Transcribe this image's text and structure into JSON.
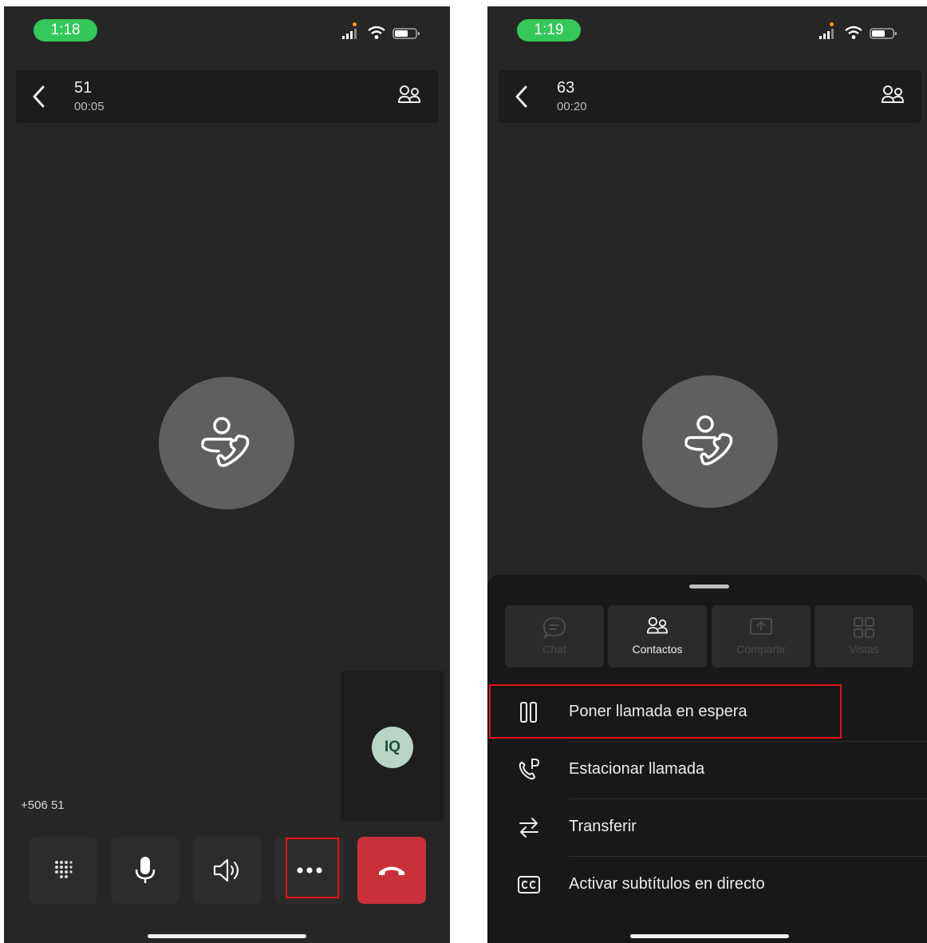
{
  "left_screen": {
    "status": {
      "time": "1:18"
    },
    "header": {
      "title": "51",
      "timer": "00:05"
    },
    "self_view": {
      "initials": "IQ"
    },
    "caller_number": "+506 51",
    "controls": {
      "dialpad_icon": "dialpad-icon",
      "mic_icon": "microphone-icon",
      "speaker_icon": "speaker-icon",
      "more_icon": "more-options-icon",
      "end_call_icon": "end-call-icon",
      "end_call_color": "#c9313a"
    }
  },
  "right_screen": {
    "status": {
      "time": "1:19"
    },
    "header": {
      "title": "63",
      "timer": "00:20"
    },
    "sheet": {
      "tiles": [
        {
          "label": "Chat",
          "enabled": false
        },
        {
          "label": "Contactos",
          "enabled": true
        },
        {
          "label": "Compartir",
          "enabled": false
        },
        {
          "label": "Vistas",
          "enabled": false
        }
      ],
      "menu": [
        {
          "label": "Poner llamada en espera",
          "icon": "pause-icon"
        },
        {
          "label": "Estacionar llamada",
          "icon": "park-call-icon"
        },
        {
          "label": "Transferir",
          "icon": "transfer-icon"
        },
        {
          "label": "Activar subtítulos en directo",
          "icon": "captions-icon"
        }
      ]
    }
  },
  "colors": {
    "status_pill": "#34c759",
    "background": "#262626",
    "highlight": "#e3111b"
  }
}
